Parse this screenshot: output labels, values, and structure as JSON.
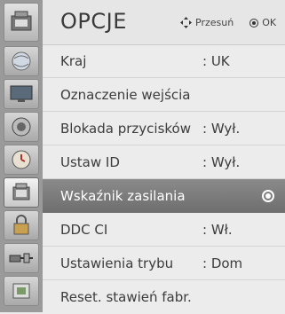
{
  "header": {
    "title": "OPCJE",
    "move_hint": "Przesuń",
    "ok_hint": "OK"
  },
  "sidebar": {
    "icons": [
      "setup-icon",
      "globe-icon",
      "monitor-icon",
      "speaker-icon",
      "clock-icon",
      "options-icon",
      "lock-icon",
      "input-cable-icon",
      "usb-media-icon"
    ]
  },
  "menu": {
    "items": [
      {
        "label": "Kraj",
        "value": ": UK"
      },
      {
        "label": "Oznaczenie wejścia",
        "value": ""
      },
      {
        "label": "Blokada przycisków",
        "value": ": Wył."
      },
      {
        "label": "Ustaw ID",
        "value": ": Wył."
      },
      {
        "label": "Wskaźnik zasilania",
        "value": ""
      },
      {
        "label": "DDC CI",
        "value": ": Wł."
      },
      {
        "label": "Ustawienia trybu",
        "value": ": Dom"
      },
      {
        "label": "Reset. stawień fabr.",
        "value": ""
      }
    ],
    "selected_label": "Wskaźnik zasilania"
  },
  "colors": {
    "selected_row": "#7c7c7c",
    "background": "#ececec",
    "sidebar": "#9a9a9a"
  }
}
